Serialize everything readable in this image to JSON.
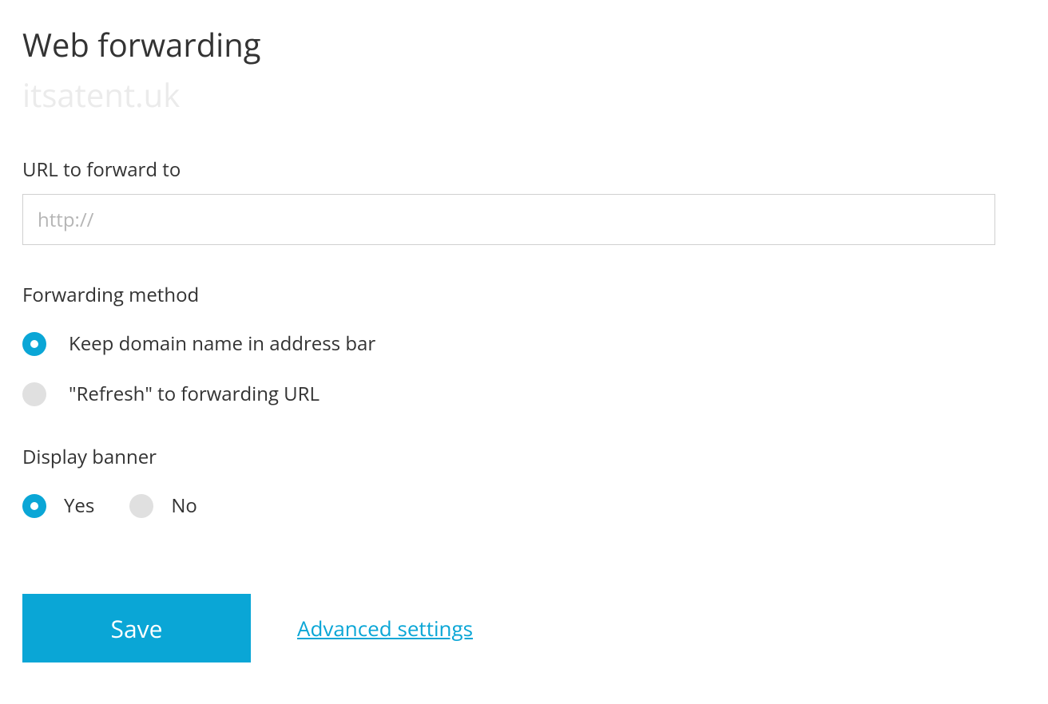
{
  "header": {
    "title": "Web forwarding",
    "domain": "itsatent.uk"
  },
  "url_field": {
    "label": "URL to forward to",
    "placeholder": "http://",
    "value": ""
  },
  "forwarding_method": {
    "label": "Forwarding method",
    "options": [
      {
        "label": "Keep domain name in address bar",
        "selected": true
      },
      {
        "label": "\"Refresh\" to forwarding URL",
        "selected": false
      }
    ]
  },
  "display_banner": {
    "label": "Display banner",
    "options": [
      {
        "label": "Yes",
        "selected": true
      },
      {
        "label": "No",
        "selected": false
      }
    ]
  },
  "actions": {
    "save_label": "Save",
    "advanced_label": "Advanced settings"
  }
}
